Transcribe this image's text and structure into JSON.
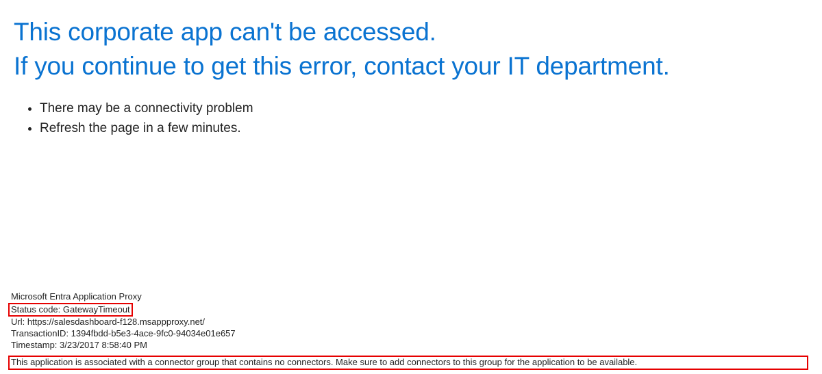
{
  "heading": {
    "line1": "This corporate app can't be accessed.",
    "line2": "If you continue to get this error, contact your IT department."
  },
  "causes": {
    "item1": "There may be a connectivity problem",
    "item2": "Refresh the page in a few minutes."
  },
  "details": {
    "product": "Microsoft Entra Application Proxy",
    "status_line": "Status code: GatewayTimeout",
    "url_line": "Url: https://salesdashboard-f128.msappproxy.net/",
    "transaction_line": "TransactionID: 1394fbdd-b5e3-4ace-9fc0-94034e01e657",
    "timestamp_line": "Timestamp: 3/23/2017 8:58:40 PM",
    "message": "This application is associated with a connector group that contains no connectors. Make sure to add connectors to this group for the application to be available."
  }
}
